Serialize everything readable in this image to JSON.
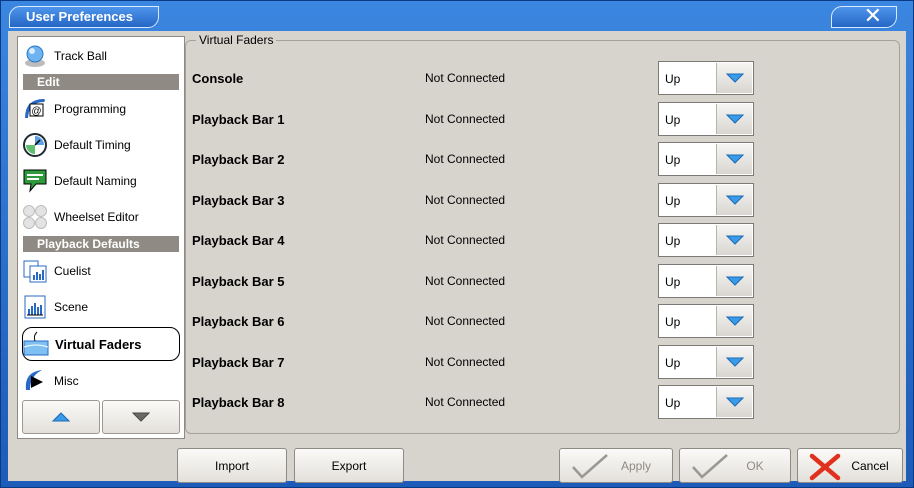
{
  "window": {
    "title": "User Preferences",
    "close_label": "✕"
  },
  "sidebar": {
    "items": [
      {
        "kind": "item",
        "label": "Track Ball",
        "icon": "trackball-icon"
      },
      {
        "kind": "header",
        "label": "Edit"
      },
      {
        "kind": "item",
        "label": "Programming",
        "icon": "programming-icon"
      },
      {
        "kind": "item",
        "label": "Default Timing",
        "icon": "clock-icon"
      },
      {
        "kind": "item",
        "label": "Default Naming",
        "icon": "naming-icon"
      },
      {
        "kind": "item",
        "label": "Wheelset Editor",
        "icon": "wheelset-icon"
      },
      {
        "kind": "header",
        "label": "Playback Defaults"
      },
      {
        "kind": "item",
        "label": "Cuelist",
        "icon": "cuelist-icon"
      },
      {
        "kind": "item",
        "label": "Scene",
        "icon": "scene-icon"
      },
      {
        "kind": "item",
        "label": "Virtual Faders",
        "icon": "virtual-faders-icon",
        "selected": true
      },
      {
        "kind": "item",
        "label": "Misc",
        "icon": "misc-icon"
      }
    ],
    "scroll_up_icon": "arrow-up-icon",
    "scroll_down_icon": "arrow-down-icon"
  },
  "group": {
    "title": "Virtual Faders",
    "rows": [
      {
        "name": "Console",
        "status": "Not Connected",
        "value": "Up"
      },
      {
        "name": "Playback Bar 1",
        "status": "Not Connected",
        "value": "Up"
      },
      {
        "name": "Playback Bar 2",
        "status": "Not Connected",
        "value": "Up"
      },
      {
        "name": "Playback Bar 3",
        "status": "Not Connected",
        "value": "Up"
      },
      {
        "name": "Playback Bar 4",
        "status": "Not Connected",
        "value": "Up"
      },
      {
        "name": "Playback Bar 5",
        "status": "Not Connected",
        "value": "Up"
      },
      {
        "name": "Playback Bar 6",
        "status": "Not Connected",
        "value": "Up"
      },
      {
        "name": "Playback Bar 7",
        "status": "Not Connected",
        "value": "Up"
      },
      {
        "name": "Playback Bar 8",
        "status": "Not Connected",
        "value": "Up"
      }
    ]
  },
  "buttons": {
    "import": "Import",
    "export": "Export",
    "apply": "Apply",
    "ok": "OK",
    "cancel": "Cancel"
  },
  "colors": {
    "title_blue": "#2566c4",
    "dropdown_arrow": "#3a9be8",
    "cancel_red": "#e0301e",
    "check_gray": "#9a9893"
  }
}
